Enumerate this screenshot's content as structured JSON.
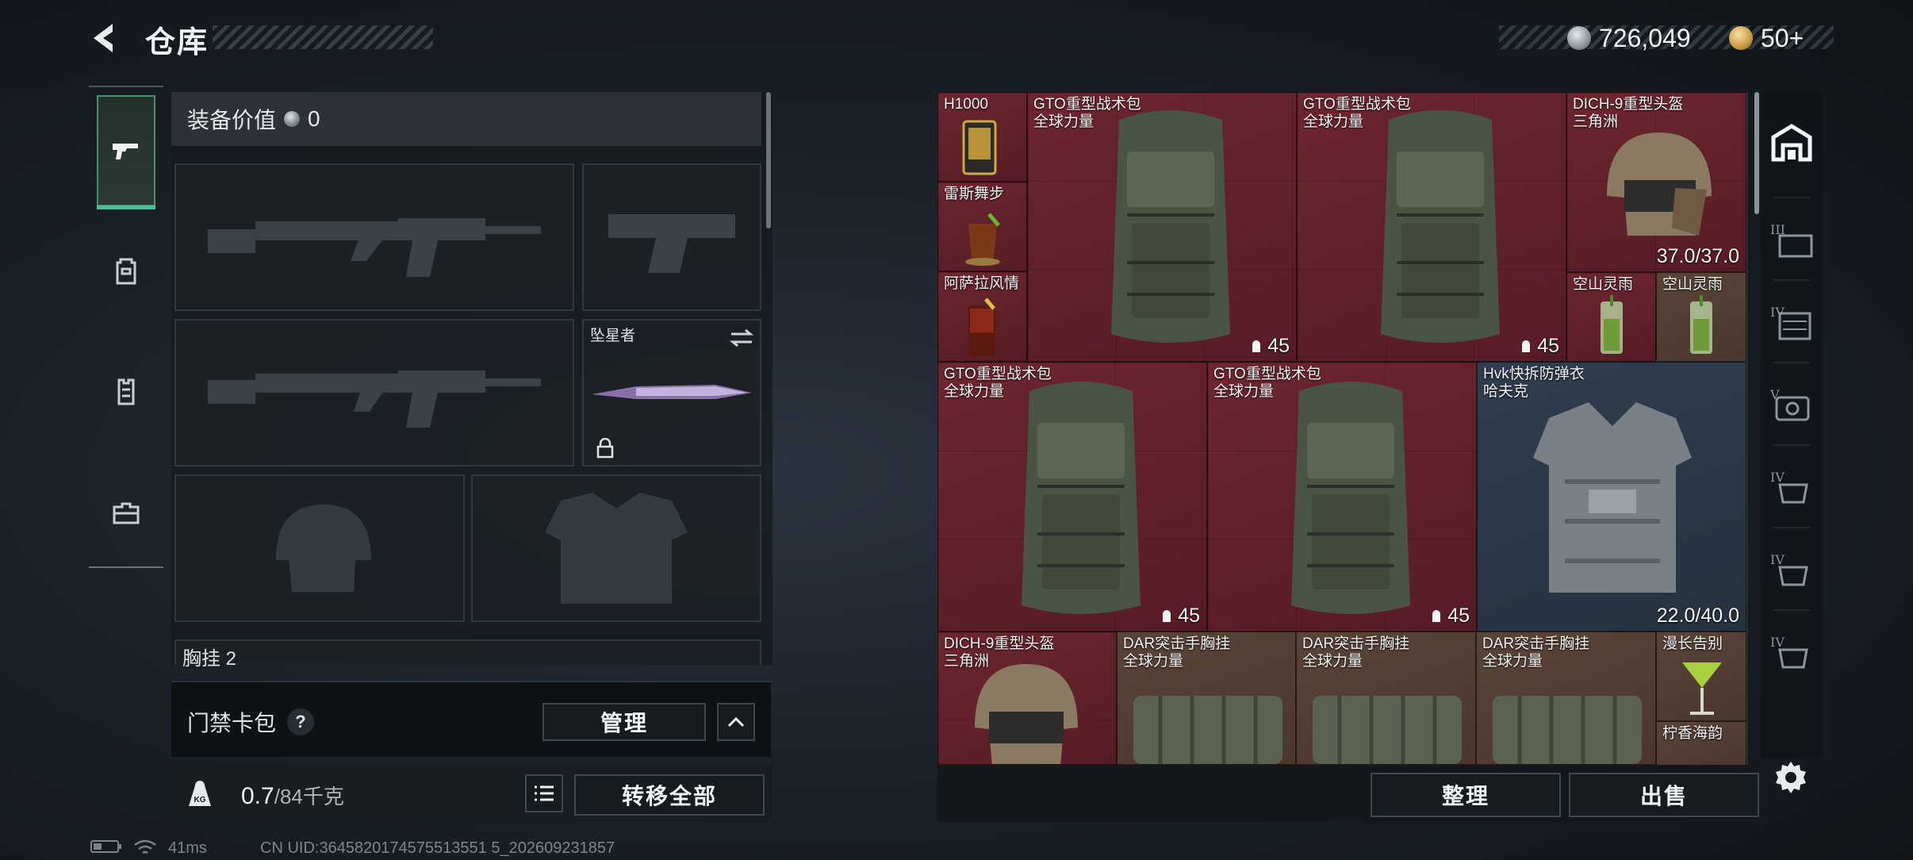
{
  "header": {
    "title": "仓库",
    "currency_silver": "726,049",
    "currency_gold": "50+"
  },
  "equipment": {
    "value_label": "装备价值",
    "value_amount": "0",
    "melee_name": "坠星者",
    "chest_label": "胸挂",
    "chest_count": "2"
  },
  "access_card": {
    "label": "门禁卡包",
    "help": "?",
    "manage_label": "管理"
  },
  "weight": {
    "current": "0.7",
    "max": "/84千克",
    "kg_label": "KG",
    "transfer_all_label": "转移全部"
  },
  "status_bar": {
    "ping": "41ms",
    "uid": "CN UID:3645820174575513551 5_202609231857"
  },
  "inventory": {
    "items": [
      {
        "name": "H1000",
        "sub": "",
        "count": ""
      },
      {
        "name": "GTO重型战术包",
        "sub": "全球力量",
        "count": "45"
      },
      {
        "name": "GTO重型战术包",
        "sub": "全球力量",
        "count": "45"
      },
      {
        "name": "DICH-9重型头盔",
        "sub": "三角洲",
        "count": "37.0/37.0"
      },
      {
        "name": "雷斯舞步",
        "sub": "",
        "count": ""
      },
      {
        "name": "阿萨拉风情",
        "sub": "",
        "count": ""
      },
      {
        "name": "空山灵雨",
        "sub": "",
        "count": ""
      },
      {
        "name": "空山灵雨",
        "sub": "",
        "count": ""
      },
      {
        "name": "GTO重型战术包",
        "sub": "全球力量",
        "count": "45"
      },
      {
        "name": "GTO重型战术包",
        "sub": "全球力量",
        "count": "45"
      },
      {
        "name": "Hvk快拆防弹衣",
        "sub": "哈夫克",
        "count": "22.0/40.0"
      },
      {
        "name": "DICH-9重型头盔",
        "sub": "三角洲",
        "count": ""
      },
      {
        "name": "DAR突击手胸挂",
        "sub": "全球力量",
        "count": ""
      },
      {
        "name": "DAR突击手胸挂",
        "sub": "全球力量",
        "count": ""
      },
      {
        "name": "DAR突击手胸挂",
        "sub": "全球力量",
        "count": ""
      },
      {
        "name": "漫长告别",
        "sub": "",
        "count": ""
      },
      {
        "name": "柠香海韵",
        "sub": "",
        "count": ""
      }
    ],
    "sort_label": "整理",
    "sell_label": "出售"
  },
  "right_rail": {
    "items": [
      "III",
      "IV",
      "V",
      "IV",
      "IV",
      "IV"
    ]
  },
  "colors": {
    "accent_green": "#3fc598",
    "cell_red": "#6c262f",
    "cell_blue": "#2f3d4e",
    "cell_brown": "#5a4438"
  },
  "icons": {
    "back": "back-arrow-icon",
    "pistol": "pistol-icon",
    "settings": "gear-icon",
    "warehouse": "warehouse-icon"
  }
}
